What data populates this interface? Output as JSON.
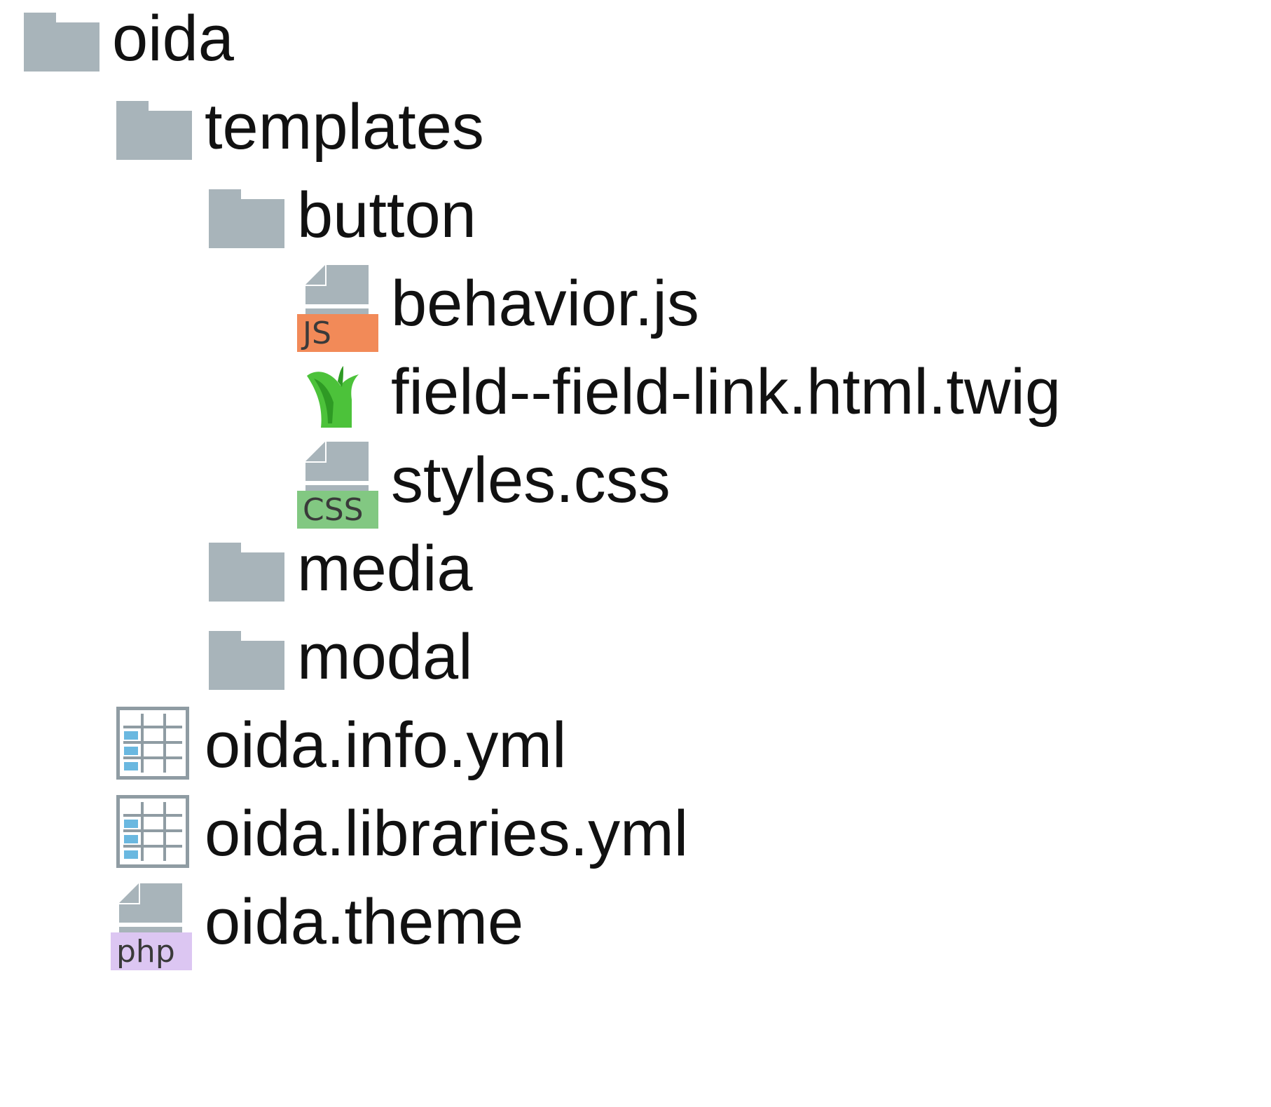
{
  "tree": {
    "items": [
      {
        "label": "oida",
        "type": "folder",
        "icon": "folder-icon"
      },
      {
        "label": "templates",
        "type": "folder",
        "icon": "folder-icon"
      },
      {
        "label": "button",
        "type": "folder",
        "icon": "folder-icon"
      },
      {
        "label": "behavior.js",
        "type": "file",
        "icon": "js-file-icon",
        "badge": "JS"
      },
      {
        "label": "field--field-link.html.twig",
        "type": "file",
        "icon": "twig-file-icon"
      },
      {
        "label": "styles.css",
        "type": "file",
        "icon": "css-file-icon",
        "badge": "CSS"
      },
      {
        "label": "media",
        "type": "folder",
        "icon": "folder-icon"
      },
      {
        "label": "modal",
        "type": "folder",
        "icon": "folder-icon"
      },
      {
        "label": "oida.info.yml",
        "type": "file",
        "icon": "yml-file-icon"
      },
      {
        "label": "oida.libraries.yml",
        "type": "file",
        "icon": "yml-file-icon"
      },
      {
        "label": "oida.theme",
        "type": "file",
        "icon": "php-file-icon",
        "badge": "php"
      }
    ]
  },
  "colors": {
    "folder": "#a8b4ba",
    "js_badge": "#f28a58",
    "css_badge": "#82c882",
    "php_badge": "#dcc6f2",
    "twig_leaf": "#4cc23a",
    "yml_cell": "#6ab8e0"
  }
}
